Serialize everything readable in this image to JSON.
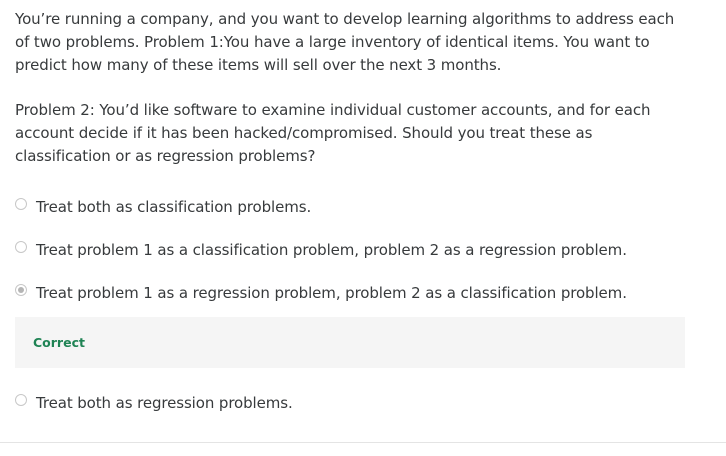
{
  "question": {
    "paragraph_1": "You’re running a company, and you want to develop learning algorithms to address each of two problems. Problem 1:You have a large inventory of identical items. You want to predict how many of these items will sell over the next 3 months.",
    "paragraph_2": "Problem 2: You’d like software to examine individual customer accounts, and for each account decide if it has been hacked/compromised. Should you treat these as classification or as regression problems?"
  },
  "options": [
    {
      "label": "Treat both as classification problems.",
      "selected": false
    },
    {
      "label": "Treat problem 1 as a classification problem, problem 2 as a regression problem.",
      "selected": false
    },
    {
      "label": "Treat problem 1 as a regression problem, problem 2 as a classification problem.",
      "selected": true
    },
    {
      "label": "Treat both as regression problems.",
      "selected": false
    }
  ],
  "feedback": {
    "text": "Correct",
    "color": "#1f8354"
  }
}
